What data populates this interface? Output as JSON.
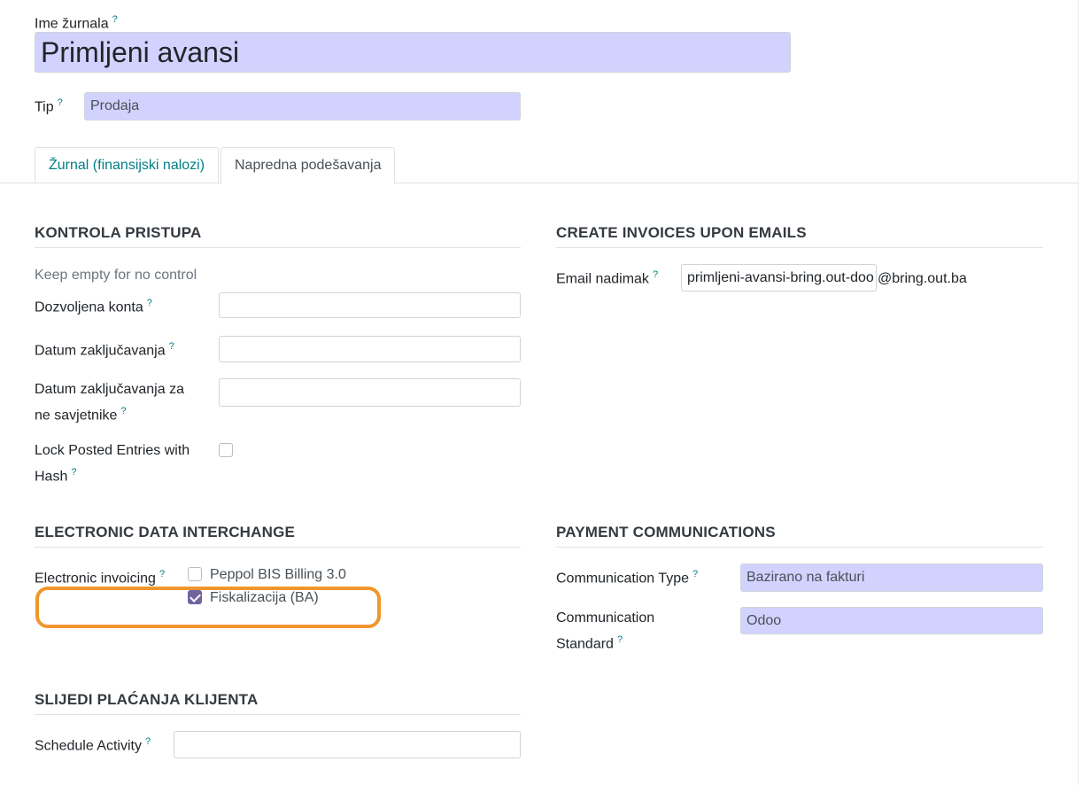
{
  "header": {
    "journal_name_label": "Ime žurnala",
    "journal_name_value": "Primljeni avansi",
    "type_label": "Tip",
    "type_value": "Prodaja",
    "help_mark": "?"
  },
  "tabs": [
    {
      "label": "Žurnal (finansijski nalozi)",
      "active": false
    },
    {
      "label": "Napredna podešavanja",
      "active": true
    }
  ],
  "access_control": {
    "title": "KONTROLA PRISTUPA",
    "hint": "Keep empty for no control",
    "allowed_accounts_label": "Dozvoljena konta",
    "lock_date_label": "Datum zaključavanja",
    "lock_date_non_advisers_label_line1": "Datum zaključavanja za",
    "lock_date_non_advisers_label_line2": "ne savjetnike",
    "lock_hash_label_line1": "Lock Posted Entries with",
    "lock_hash_label_line2": "Hash"
  },
  "emails": {
    "title": "CREATE INVOICES UPON EMAILS",
    "alias_label": "Email nadimak",
    "alias_value": "primljeni-avansi-bring.out-doo",
    "alias_domain": "@bring.out.ba"
  },
  "edi": {
    "title": "ELECTRONIC DATA INTERCHANGE",
    "label": "Electronic invoicing",
    "options": [
      {
        "label": "Peppol BIS Billing 3.0",
        "checked": false
      },
      {
        "label": "Fiskalizacija (BA)",
        "checked": true
      }
    ],
    "highlight_color": "#f0962d"
  },
  "payment_comm": {
    "title": "PAYMENT COMMUNICATIONS",
    "type_label": "Communication Type",
    "type_value": "Bazirano na fakturi",
    "standard_label_line1": "Communication",
    "standard_label_line2": "Standard",
    "standard_value": "Odoo"
  },
  "followup": {
    "title": "SLIJEDI PLAĆANJA KLIJENTA",
    "schedule_label": "Schedule Activity"
  },
  "colors": {
    "required_bg": "#d2d2ff",
    "help": "#017e84",
    "check": "#71639e"
  }
}
